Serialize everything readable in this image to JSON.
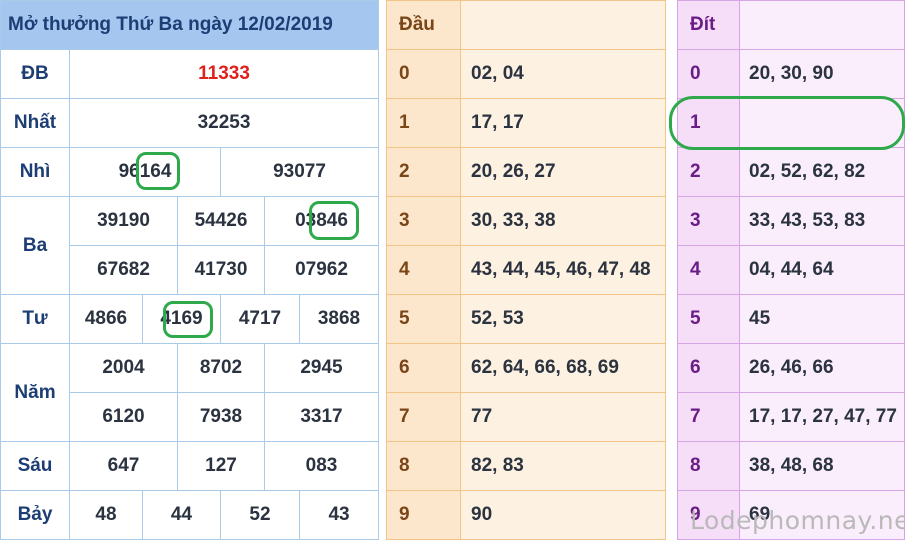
{
  "title": "Mở thưởng Thứ Ba ngày 12/02/2019",
  "prizes": {
    "db": {
      "label": "ĐB",
      "values": [
        "11333"
      ]
    },
    "nhat": {
      "label": "Nhất",
      "values": [
        "32253"
      ]
    },
    "nhi": {
      "label": "Nhì",
      "values": [
        "96164",
        "93077"
      ]
    },
    "ba": {
      "label": "Ba",
      "values": [
        "39190",
        "54426",
        "03846",
        "67682",
        "41730",
        "07962"
      ]
    },
    "tu": {
      "label": "Tư",
      "values": [
        "4866",
        "4169",
        "4717",
        "3868"
      ]
    },
    "nam": {
      "label": "Năm",
      "values": [
        "2004",
        "8702",
        "2945",
        "6120",
        "7938",
        "3317"
      ]
    },
    "sau": {
      "label": "Sáu",
      "values": [
        "647",
        "127",
        "083"
      ]
    },
    "bay": {
      "label": "Bảy",
      "values": [
        "48",
        "44",
        "52",
        "43"
      ]
    }
  },
  "dau": {
    "header": "Đầu",
    "rows": [
      {
        "k": "0",
        "v": "02, 04"
      },
      {
        "k": "1",
        "v": "17, 17"
      },
      {
        "k": "2",
        "v": "20, 26, 27"
      },
      {
        "k": "3",
        "v": "30, 33, 38"
      },
      {
        "k": "4",
        "v": "43, 44, 45, 46, 47, 48"
      },
      {
        "k": "5",
        "v": "52, 53"
      },
      {
        "k": "6",
        "v": "62, 64, 66, 68, 69"
      },
      {
        "k": "7",
        "v": "77"
      },
      {
        "k": "8",
        "v": "82, 83"
      },
      {
        "k": "9",
        "v": "90"
      }
    ]
  },
  "dit": {
    "header": "Đít",
    "rows": [
      {
        "k": "0",
        "v": "20, 30, 90"
      },
      {
        "k": "1",
        "v": ""
      },
      {
        "k": "2",
        "v": "02, 52, 62, 82"
      },
      {
        "k": "3",
        "v": "33, 43, 53, 83"
      },
      {
        "k": "4",
        "v": "04, 44, 64"
      },
      {
        "k": "5",
        "v": "45"
      },
      {
        "k": "6",
        "v": "26, 46, 66"
      },
      {
        "k": "7",
        "v": "17, 17, 27, 47, 77"
      },
      {
        "k": "8",
        "v": "38, 48, 68"
      },
      {
        "k": "9",
        "v": "69"
      }
    ]
  },
  "watermark": "Lodephomnay.net",
  "colors": {
    "highlight": "#e0201b",
    "circle": "#2ea94b"
  }
}
